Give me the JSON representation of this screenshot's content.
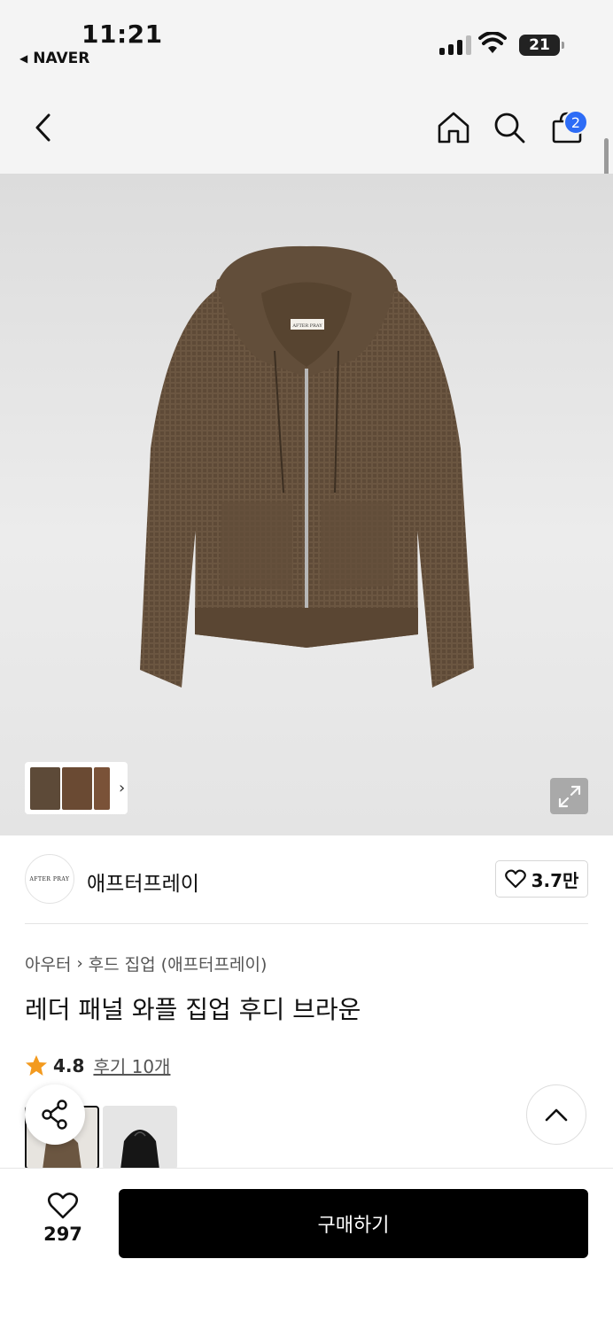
{
  "status_bar": {
    "time": "11:21",
    "back_app": "NAVER",
    "battery": "21"
  },
  "header": {
    "back_icon": "chevron-left-icon",
    "home_icon": "home-icon",
    "search_icon": "search-icon",
    "bag_icon": "shopping-bag-icon",
    "bag_count": "2"
  },
  "product_image": {
    "label_text": "AFTER PRAY",
    "garment_color": "#6b5641"
  },
  "brand": {
    "logo_text": "AFTER PRAY",
    "name": "애프터프레이",
    "like_count": "3.7만"
  },
  "breadcrumb": {
    "category": "아우터",
    "subcategory": "후드 집업 (애프터프레이)"
  },
  "product": {
    "title": "레더 패널 와플 집업 후디 브라운",
    "rating": "4.8",
    "reviews": "후기 10개"
  },
  "colors": {
    "accent_badge": "#2d6cf6",
    "star": "#f39a1e"
  },
  "bottom_bar": {
    "wish_count": "297",
    "buy_label": "구매하기"
  }
}
